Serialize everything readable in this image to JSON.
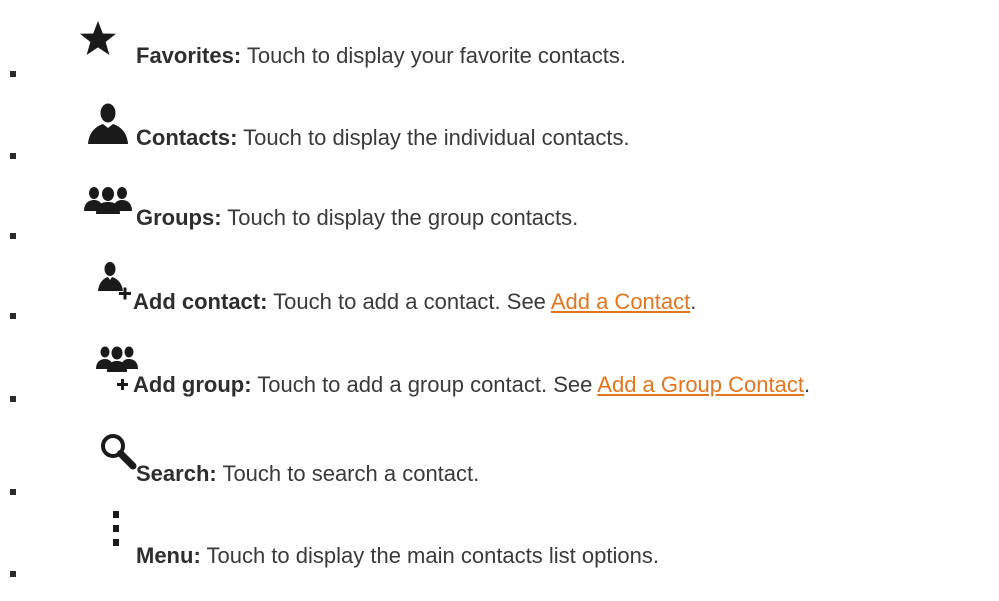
{
  "items": [
    {
      "icon": "star-icon",
      "label": "Favorites:",
      "desc": "Touch to display your favorite contacts."
    },
    {
      "icon": "person-icon",
      "label": "Contacts:",
      "desc": "Touch to display the individual contacts."
    },
    {
      "icon": "group-icon",
      "label": "Groups:",
      "desc": "Touch to display the group contacts."
    },
    {
      "icon": "add-person-icon",
      "label": "Add contact:",
      "desc": "Touch to add a contact. See ",
      "link": "Add a Contact",
      "after": "."
    },
    {
      "icon": "add-group-icon",
      "label": "Add group:",
      "desc": "Touch to add a group contact. See ",
      "link": "Add a Group Contact",
      "after": "."
    },
    {
      "icon": "search-icon",
      "label": "Search:",
      "desc": "Touch to search a contact."
    },
    {
      "icon": "menu-icon",
      "label": "Menu:",
      "desc": "Touch to display the main contacts list options."
    }
  ],
  "colors": {
    "text": "#3a3a3a",
    "link": "#e2761f",
    "icon": "#1a1a1a"
  }
}
